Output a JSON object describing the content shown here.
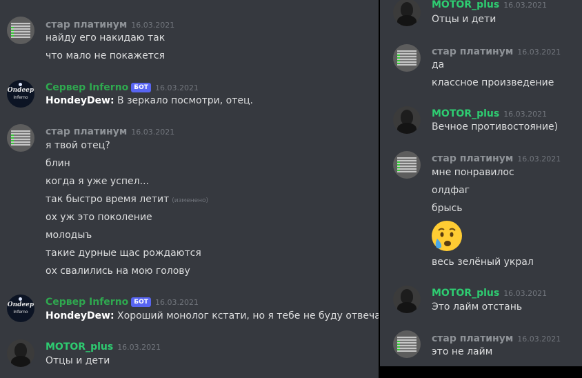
{
  "left": {
    "groups": [
      {
        "author": "стар платинум",
        "date": "16.03.2021",
        "lines": [
          "найду его накидаю так",
          "что мало не покажется"
        ]
      },
      {
        "author": "Сервер Inferno",
        "badge": "БОТ",
        "date": "16.03.2021",
        "avatar_text": [
          "Ondeep",
          "Inferno"
        ],
        "mention": "HondeyDew:",
        "text": "В зеркало посмотри, отец."
      },
      {
        "author": "стар платинум",
        "date": "16.03.2021",
        "lines": [
          "я твой отец?",
          "блин",
          "когда я уже успел...",
          "так быстро время летит",
          "ох уж это поколение",
          "молодыъ",
          "такие дурные щас рождаются",
          "ох свалились на мою голову"
        ],
        "edited": "(изменено)"
      },
      {
        "author": "Сервер Inferno",
        "badge": "БОТ",
        "date": "16.03.2021",
        "avatar_text": [
          "Ondeep",
          "Inferno"
        ],
        "mention": "HondeyDew:",
        "text": "Хороший монолог кстати, но я тебе не буду отвечать :С"
      },
      {
        "author": "MOTOR_plus",
        "date": "16.03.2021",
        "lines": [
          "Отцы и дети"
        ]
      }
    ]
  },
  "right": {
    "groups": [
      {
        "author": "MOTOR_plus",
        "date": "16.03.2021",
        "lines": [
          "Отцы и дети"
        ]
      },
      {
        "author": "стар платинум",
        "date": "16.03.2021",
        "lines": [
          "да",
          "классное произведение"
        ]
      },
      {
        "author": "MOTOR_plus",
        "date": "16.03.2021",
        "lines": [
          "Вечное противостояние)"
        ]
      },
      {
        "author": "стар платинум",
        "date": "16.03.2021",
        "lines": [
          "мне понравилос",
          "олдфаг",
          "брысь",
          "весь зелёный украл"
        ],
        "emoji": "crying-face"
      },
      {
        "author": "MOTOR_plus",
        "date": "16.03.2021",
        "lines": [
          "Это лайм отстань"
        ]
      },
      {
        "author": "стар платинум",
        "date": "16.03.2021",
        "lines": [
          "это не лайм"
        ]
      }
    ]
  },
  "colors": {
    "background": "#36393f",
    "username_gray": "#8e9297",
    "username_green": "#2ecc71",
    "bot_name": "#2fa84f",
    "badge": "#5865f2",
    "text": "#dcddde",
    "timestamp": "#72767d"
  }
}
